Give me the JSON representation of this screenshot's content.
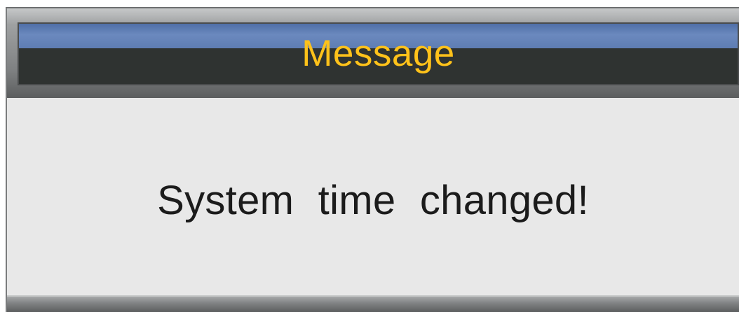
{
  "dialog": {
    "title": "Message",
    "message": "System  time  changed!"
  },
  "colors": {
    "title_text": "#ffc21a",
    "title_bar": "#2f3331",
    "title_highlight": "#6b89be",
    "content_background": "#e8e8e8",
    "message_text": "#1b1b1b"
  }
}
